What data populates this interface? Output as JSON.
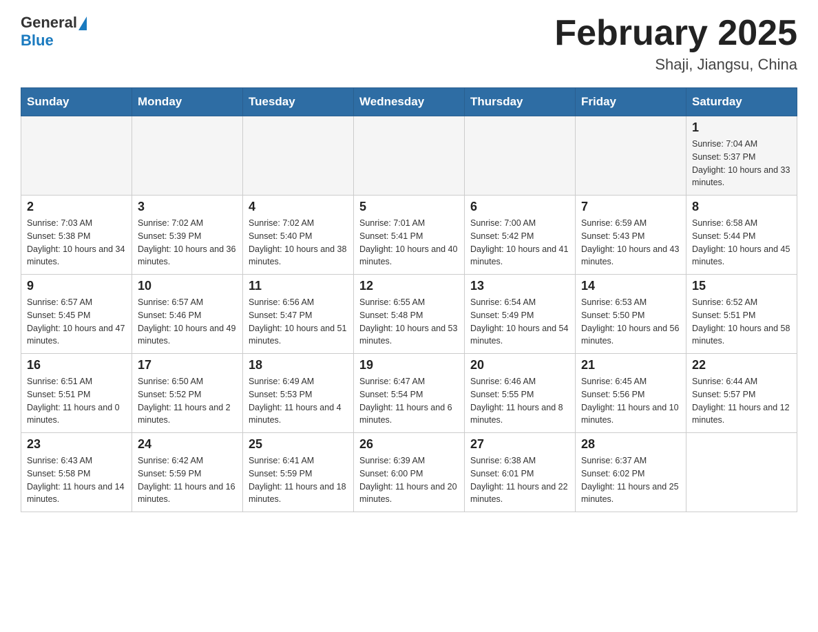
{
  "header": {
    "logo_general": "General",
    "logo_blue": "Blue",
    "month_title": "February 2025",
    "location": "Shaji, Jiangsu, China"
  },
  "days_of_week": [
    "Sunday",
    "Monday",
    "Tuesday",
    "Wednesday",
    "Thursday",
    "Friday",
    "Saturday"
  ],
  "weeks": [
    [
      {
        "day": "",
        "info": ""
      },
      {
        "day": "",
        "info": ""
      },
      {
        "day": "",
        "info": ""
      },
      {
        "day": "",
        "info": ""
      },
      {
        "day": "",
        "info": ""
      },
      {
        "day": "",
        "info": ""
      },
      {
        "day": "1",
        "info": "Sunrise: 7:04 AM\nSunset: 5:37 PM\nDaylight: 10 hours and 33 minutes."
      }
    ],
    [
      {
        "day": "2",
        "info": "Sunrise: 7:03 AM\nSunset: 5:38 PM\nDaylight: 10 hours and 34 minutes."
      },
      {
        "day": "3",
        "info": "Sunrise: 7:02 AM\nSunset: 5:39 PM\nDaylight: 10 hours and 36 minutes."
      },
      {
        "day": "4",
        "info": "Sunrise: 7:02 AM\nSunset: 5:40 PM\nDaylight: 10 hours and 38 minutes."
      },
      {
        "day": "5",
        "info": "Sunrise: 7:01 AM\nSunset: 5:41 PM\nDaylight: 10 hours and 40 minutes."
      },
      {
        "day": "6",
        "info": "Sunrise: 7:00 AM\nSunset: 5:42 PM\nDaylight: 10 hours and 41 minutes."
      },
      {
        "day": "7",
        "info": "Sunrise: 6:59 AM\nSunset: 5:43 PM\nDaylight: 10 hours and 43 minutes."
      },
      {
        "day": "8",
        "info": "Sunrise: 6:58 AM\nSunset: 5:44 PM\nDaylight: 10 hours and 45 minutes."
      }
    ],
    [
      {
        "day": "9",
        "info": "Sunrise: 6:57 AM\nSunset: 5:45 PM\nDaylight: 10 hours and 47 minutes."
      },
      {
        "day": "10",
        "info": "Sunrise: 6:57 AM\nSunset: 5:46 PM\nDaylight: 10 hours and 49 minutes."
      },
      {
        "day": "11",
        "info": "Sunrise: 6:56 AM\nSunset: 5:47 PM\nDaylight: 10 hours and 51 minutes."
      },
      {
        "day": "12",
        "info": "Sunrise: 6:55 AM\nSunset: 5:48 PM\nDaylight: 10 hours and 53 minutes."
      },
      {
        "day": "13",
        "info": "Sunrise: 6:54 AM\nSunset: 5:49 PM\nDaylight: 10 hours and 54 minutes."
      },
      {
        "day": "14",
        "info": "Sunrise: 6:53 AM\nSunset: 5:50 PM\nDaylight: 10 hours and 56 minutes."
      },
      {
        "day": "15",
        "info": "Sunrise: 6:52 AM\nSunset: 5:51 PM\nDaylight: 10 hours and 58 minutes."
      }
    ],
    [
      {
        "day": "16",
        "info": "Sunrise: 6:51 AM\nSunset: 5:51 PM\nDaylight: 11 hours and 0 minutes."
      },
      {
        "day": "17",
        "info": "Sunrise: 6:50 AM\nSunset: 5:52 PM\nDaylight: 11 hours and 2 minutes."
      },
      {
        "day": "18",
        "info": "Sunrise: 6:49 AM\nSunset: 5:53 PM\nDaylight: 11 hours and 4 minutes."
      },
      {
        "day": "19",
        "info": "Sunrise: 6:47 AM\nSunset: 5:54 PM\nDaylight: 11 hours and 6 minutes."
      },
      {
        "day": "20",
        "info": "Sunrise: 6:46 AM\nSunset: 5:55 PM\nDaylight: 11 hours and 8 minutes."
      },
      {
        "day": "21",
        "info": "Sunrise: 6:45 AM\nSunset: 5:56 PM\nDaylight: 11 hours and 10 minutes."
      },
      {
        "day": "22",
        "info": "Sunrise: 6:44 AM\nSunset: 5:57 PM\nDaylight: 11 hours and 12 minutes."
      }
    ],
    [
      {
        "day": "23",
        "info": "Sunrise: 6:43 AM\nSunset: 5:58 PM\nDaylight: 11 hours and 14 minutes."
      },
      {
        "day": "24",
        "info": "Sunrise: 6:42 AM\nSunset: 5:59 PM\nDaylight: 11 hours and 16 minutes."
      },
      {
        "day": "25",
        "info": "Sunrise: 6:41 AM\nSunset: 5:59 PM\nDaylight: 11 hours and 18 minutes."
      },
      {
        "day": "26",
        "info": "Sunrise: 6:39 AM\nSunset: 6:00 PM\nDaylight: 11 hours and 20 minutes."
      },
      {
        "day": "27",
        "info": "Sunrise: 6:38 AM\nSunset: 6:01 PM\nDaylight: 11 hours and 22 minutes."
      },
      {
        "day": "28",
        "info": "Sunrise: 6:37 AM\nSunset: 6:02 PM\nDaylight: 11 hours and 25 minutes."
      },
      {
        "day": "",
        "info": ""
      }
    ]
  ]
}
